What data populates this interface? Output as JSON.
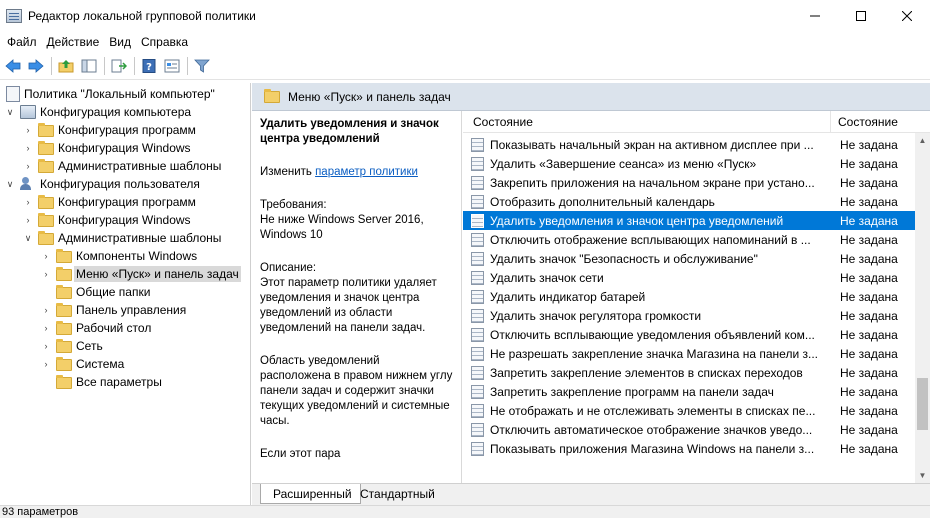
{
  "window": {
    "title": "Редактор локальной групповой политики",
    "controls": [
      "minimize",
      "maximize",
      "close"
    ]
  },
  "menu": [
    "Файл",
    "Действие",
    "Вид",
    "Справка"
  ],
  "toolbar": {
    "buttons": [
      "back-icon",
      "forward-icon",
      "up-folder-icon",
      "show-hide-tree-icon",
      "export-icon",
      "help-icon",
      "properties-icon",
      "filter-icon"
    ]
  },
  "tree": {
    "root": "Политика \"Локальный компьютер\"",
    "computer_config": "Конфигурация компьютера",
    "comp_programs": "Конфигурация программ",
    "comp_windows": "Конфигурация Windows",
    "comp_admin": "Административные шаблоны",
    "user_config": "Конфигурация пользователя",
    "user_programs": "Конфигурация программ",
    "user_windows": "Конфигурация Windows",
    "user_admin": "Административные шаблоны",
    "admin_items": [
      "Компоненты Windows",
      "Меню «Пуск» и панель задач",
      "Общие папки",
      "Панель управления",
      "Рабочий стол",
      "Сеть",
      "Система",
      "Все параметры"
    ]
  },
  "right": {
    "header": "Меню «Пуск» и панель задач",
    "description": {
      "title": "Удалить уведомления и значок центра уведомлений",
      "edit_prefix": "Изменить",
      "edit_link": "параметр политики",
      "requirements_label": "Требования:",
      "requirements_text": "Не ниже Windows Server 2016, Windows 10",
      "description_label": "Описание:",
      "description_text": "Этот параметр политики удаляет уведомления и значок центра уведомлений из области уведомлений на панели задач.",
      "paragraph2": "Область уведомлений расположена в правом нижнем углу панели задач и содержит значки текущих уведомлений и системные часы.",
      "paragraph3": "Если этот пара"
    },
    "columns": {
      "name": "Состояние",
      "state": "Состояние"
    },
    "rows": [
      {
        "name": "Показывать начальный экран на активном дисплее при ...",
        "state": "Не задана"
      },
      {
        "name": "Удалить «Завершение сеанса» из меню «Пуск»",
        "state": "Не задана"
      },
      {
        "name": "Закрепить приложения на начальном экране при устано...",
        "state": "Не задана"
      },
      {
        "name": "Отобразить дополнительный календарь",
        "state": "Не задана"
      },
      {
        "name": "Удалить уведомления и значок центра уведомлений",
        "state": "Не задана"
      },
      {
        "name": "Отключить отображение всплывающих напоминаний в ...",
        "state": "Не задана"
      },
      {
        "name": "Удалить значок \"Безопасность и обслуживание\"",
        "state": "Не задана"
      },
      {
        "name": "Удалить значок сети",
        "state": "Не задана"
      },
      {
        "name": "Удалить индикатор батарей",
        "state": "Не задана"
      },
      {
        "name": "Удалить значок регулятора громкости",
        "state": "Не задана"
      },
      {
        "name": "Отключить всплывающие уведомления объявлений ком...",
        "state": "Не задана"
      },
      {
        "name": "Не разрешать закрепление значка Магазина на панели з...",
        "state": "Не задана"
      },
      {
        "name": "Запретить закрепление элементов в списках переходов",
        "state": "Не задана"
      },
      {
        "name": "Запретить закрепление программ на панели задач",
        "state": "Не задана"
      },
      {
        "name": "Не отображать и не отслеживать элементы в списках пе...",
        "state": "Не задана"
      },
      {
        "name": "Отключить автоматическое отображение значков уведо...",
        "state": "Не задана"
      },
      {
        "name": "Показывать приложения Магазина Windows на панели з...",
        "state": "Не задана"
      }
    ],
    "selected_row": 4,
    "tabs": [
      "Расширенный",
      "Стандартный"
    ]
  },
  "status": "93 параметров"
}
